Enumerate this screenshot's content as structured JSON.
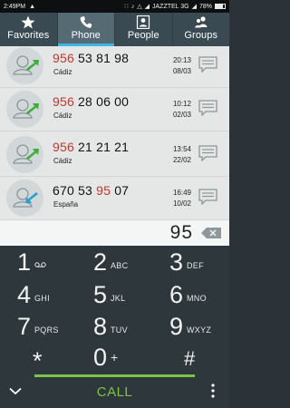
{
  "status_bar": {
    "time": "2:49PM",
    "carrier": "JAZZTEL 3G",
    "battery": "78%",
    "battery_level": 0.78
  },
  "tabs": [
    {
      "label": "Favorites",
      "icon": "star-icon",
      "active": false
    },
    {
      "label": "Phone",
      "icon": "phone-icon",
      "active": true
    },
    {
      "label": "People",
      "icon": "contact-card-icon",
      "active": false
    },
    {
      "label": "Groups",
      "icon": "group-icon",
      "active": false
    }
  ],
  "call_log": [
    {
      "number_match": "956",
      "number_rest": " 53 81 98",
      "location": "Cádiz",
      "time": "20:13",
      "date": "08/03",
      "direction": "outgoing"
    },
    {
      "number_match": "956",
      "number_rest": " 28 06 00",
      "location": "Cádiz",
      "time": "10:12",
      "date": "02/03",
      "direction": "outgoing"
    },
    {
      "number_match": "956",
      "number_rest": " 21 21 21",
      "location": "Cádiz",
      "time": "13:54",
      "date": "22/02",
      "direction": "outgoing"
    },
    {
      "number_pre": "670 53 ",
      "number_match": "95",
      "number_rest": " 07",
      "location": "España",
      "time": "16:49",
      "date": "10/02",
      "direction": "incoming"
    }
  ],
  "dial_input": {
    "value": "95"
  },
  "keypad": {
    "keys": [
      {
        "digit": "1",
        "letters": "voicemail"
      },
      {
        "digit": "2",
        "letters": "ABC"
      },
      {
        "digit": "3",
        "letters": "DEF"
      },
      {
        "digit": "4",
        "letters": "GHI"
      },
      {
        "digit": "5",
        "letters": "JKL"
      },
      {
        "digit": "6",
        "letters": "MNO"
      },
      {
        "digit": "7",
        "letters": "PQRS"
      },
      {
        "digit": "8",
        "letters": "TUV"
      },
      {
        "digit": "9",
        "letters": "WXYZ"
      },
      {
        "digit": "*",
        "letters": ""
      },
      {
        "digit": "0",
        "letters": "+"
      },
      {
        "digit": "#",
        "letters": ""
      }
    ]
  },
  "call_button": {
    "label": "CALL"
  },
  "colors": {
    "tab_bg": "#3a4a52",
    "tab_active_bg": "#566a74",
    "tab_indicator": "#3db6e3",
    "match_highlight": "#c0392b",
    "outgoing_arrow": "#3fae3a",
    "incoming_arrow": "#2a9fd0",
    "call_green": "#7dc24a",
    "keypad_bg": "#2e373c"
  }
}
